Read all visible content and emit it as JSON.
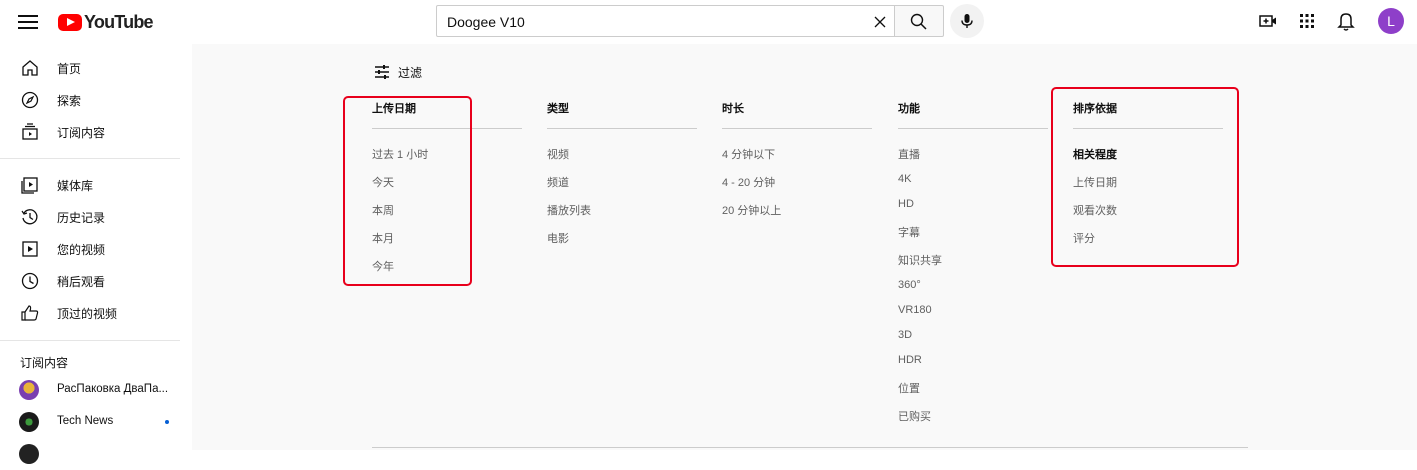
{
  "header": {
    "logo_text": "YouTube",
    "search_value": "Doogee V10",
    "avatar_letter": "L"
  },
  "sidebar": {
    "main": [
      {
        "label": "首页",
        "icon": "home-icon"
      },
      {
        "label": "探索",
        "icon": "compass-icon"
      },
      {
        "label": "订阅内容",
        "icon": "subscriptions-icon"
      }
    ],
    "library": [
      {
        "label": "媒体库",
        "icon": "library-icon"
      },
      {
        "label": "历史记录",
        "icon": "history-icon"
      },
      {
        "label": "您的视频",
        "icon": "your-videos-icon"
      },
      {
        "label": "稍后观看",
        "icon": "watch-later-icon"
      },
      {
        "label": "顶过的视频",
        "icon": "liked-videos-icon"
      }
    ],
    "subscriptions_heading": "订阅内容",
    "subscriptions": [
      {
        "label": "РасПаковка ДваПа...",
        "has_dot": false
      },
      {
        "label": "Tech News",
        "has_dot": true
      }
    ]
  },
  "filters": {
    "toggle_label": "过滤",
    "columns": [
      {
        "heading": "上传日期",
        "items": [
          "过去 1 小时",
          "今天",
          "本周",
          "本月",
          "今年"
        ]
      },
      {
        "heading": "类型",
        "items": [
          "视频",
          "频道",
          "播放列表",
          "电影"
        ]
      },
      {
        "heading": "时长",
        "items": [
          "4 分钟以下",
          "4 - 20 分钟",
          "20 分钟以上"
        ]
      },
      {
        "heading": "功能",
        "items": [
          "直播",
          "4K",
          "HD",
          "字幕",
          "知识共享",
          "360°",
          "VR180",
          "3D",
          "HDR",
          "位置",
          "已购买"
        ]
      },
      {
        "heading": "排序依据",
        "items": [
          "相关程度",
          "上传日期",
          "观看次数",
          "评分"
        ],
        "selected": "相关程度"
      }
    ]
  },
  "colors": {
    "highlight_box": "#e8001c",
    "youtube_red": "#ff0000",
    "avatar_bg": "#8e3fc9"
  }
}
